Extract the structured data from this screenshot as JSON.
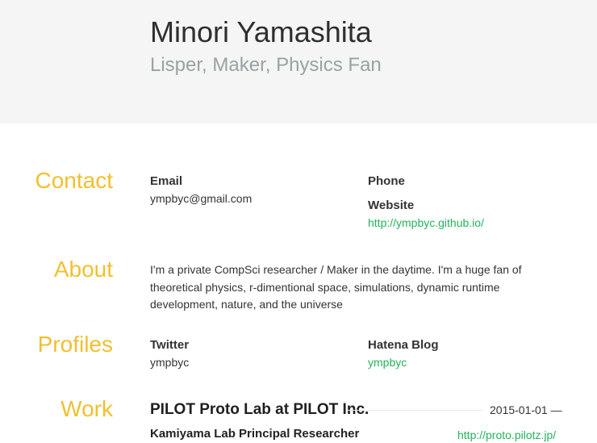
{
  "header": {
    "name": "Minori Yamashita",
    "tagline": "Lisper, Maker, Physics Fan"
  },
  "sections": {
    "contact": {
      "title": "Contact",
      "email_label": "Email",
      "email_value": "ympbyc@gmail.com",
      "phone_label": "Phone",
      "website_label": "Website",
      "website_value": "http://ympbyc.github.io/"
    },
    "about": {
      "title": "About",
      "line_1": "I'm a private CompSci researcher / Maker in the daytime. I'm a huge fan of",
      "line_2": "theoretical physics, r-dimentional space, simulations, dynamic runtime",
      "line_3": "development, nature, and the universe"
    },
    "profiles": {
      "title": "Profiles",
      "twitter_label": "Twitter",
      "twitter_value": "ympbyc",
      "hatena_label": "Hatena Blog",
      "hatena_value": "ympbyc"
    },
    "work": {
      "title": "Work",
      "company": "PILOT Proto Lab at PILOT Inc.",
      "date": "2015-01-01 —",
      "role": "Kamiyama Lab Principal Researcher",
      "url": "http://proto.pilotz.jp/"
    }
  },
  "colors": {
    "header_bg": "#f4f5f4",
    "section_title": "#f0c02e",
    "link": "#22b35a",
    "tagline": "#98a3a3"
  }
}
